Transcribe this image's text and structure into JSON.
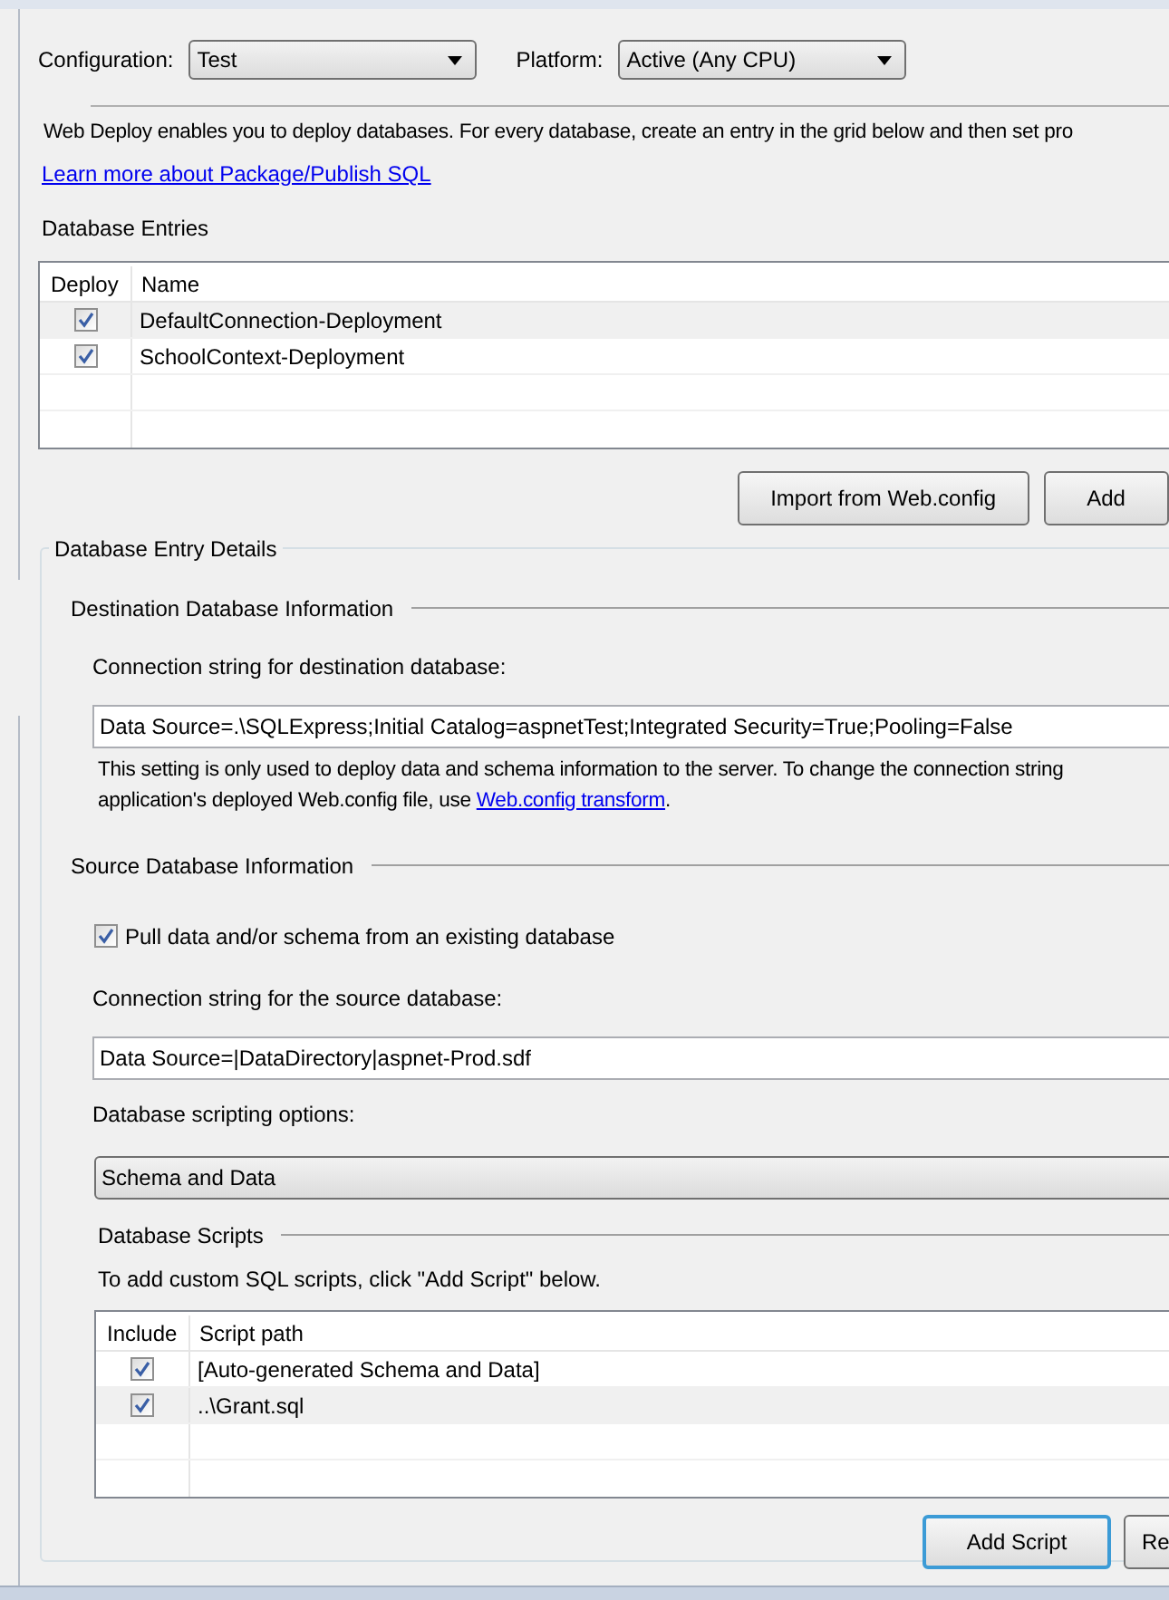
{
  "configuration": {
    "label": "Configuration:",
    "value": "Test"
  },
  "platform": {
    "label": "Platform:",
    "value": "Active (Any CPU)"
  },
  "intro": "Web Deploy enables you to deploy databases. For every database, create an entry in the grid below and then set pro",
  "learn_more_link": "Learn more about Package/Publish SQL",
  "database_entries": {
    "title": "Database Entries",
    "columns": [
      "Deploy",
      "Name"
    ],
    "rows": [
      {
        "deploy": true,
        "name": "DefaultConnection-Deployment",
        "selected": true
      },
      {
        "deploy": true,
        "name": "SchoolContext-Deployment",
        "selected": false
      }
    ]
  },
  "entry_buttons": [
    {
      "label": "Import from Web.config",
      "focused": false
    },
    {
      "label": "Add",
      "focused": false
    }
  ],
  "details": {
    "title": "Database Entry Details",
    "destination": {
      "title": "Destination Database Information",
      "connection_label": "Connection string for destination database:",
      "connection_value": "Data Source=.\\SQLExpress;Initial Catalog=aspnetTest;Integrated Security=True;Pooling=False",
      "note_line1": "This setting is only used to deploy data and schema information to the server. To change the connection string",
      "note_line2": "application's deployed Web.config file, use ",
      "note_link": "Web.config transform",
      "note_end": "."
    },
    "source": {
      "title": "Source Database Information",
      "pull": {
        "label": "Pull data and/or schema from an existing database",
        "checked": true
      },
      "connection_label": "Connection string for the source database:",
      "connection_value": "Data Source=|DataDirectory|aspnet-Prod.sdf",
      "scripting_label": "Database scripting options:",
      "scripting_value": "Schema and Data"
    },
    "scripts": {
      "title": "Database Scripts",
      "hint": "To add custom SQL scripts, click \"Add Script\" below.",
      "columns": [
        "Include",
        "Script path"
      ],
      "rows": [
        {
          "include": true,
          "path": "[Auto-generated Schema and Data]",
          "selected": false
        },
        {
          "include": true,
          "path": "..\\Grant.sql",
          "selected": true
        }
      ],
      "buttons": [
        {
          "label": "Add Script",
          "focused": true
        },
        {
          "label": "Re",
          "focused": false
        }
      ]
    }
  }
}
